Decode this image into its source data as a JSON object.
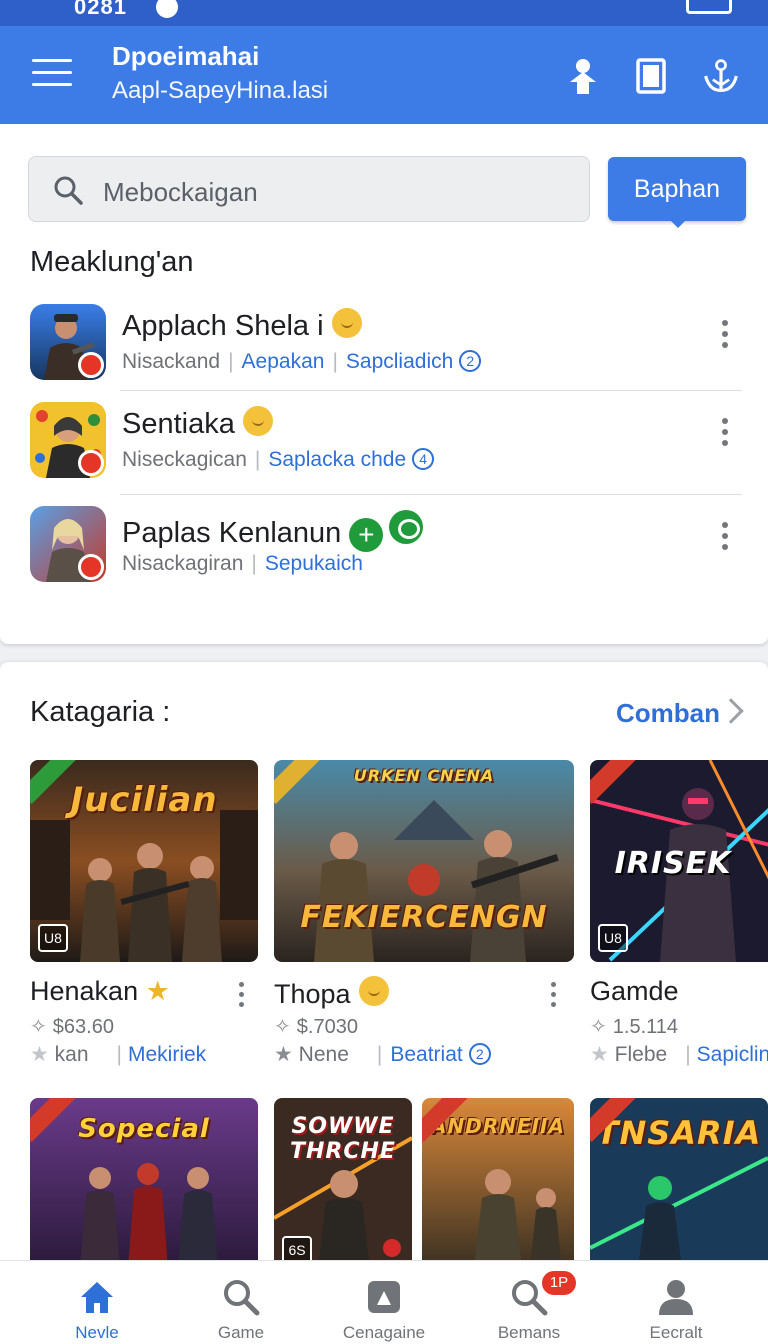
{
  "status_bar": {
    "time": "0281"
  },
  "app_bar": {
    "title": "Dpoeimahai",
    "subtitle": "Aapl-SapeyHina.lasi"
  },
  "search": {
    "placeholder": "Mebockaigan",
    "button_label": "Baphan"
  },
  "recent": {
    "heading": "Meaklung'an",
    "items": [
      {
        "title": "Applach Shela i",
        "meta1": "Nisackand",
        "meta2": "Aepakan",
        "meta3": "Sapcliadich",
        "num": "2"
      },
      {
        "title": "Sentiaka",
        "meta1": "Niseckagican",
        "meta2": "Saplacka chde",
        "num": "4"
      },
      {
        "title": "Paplas Kenlanun",
        "meta1": "Nisackagiran",
        "meta2": "Sepukaich"
      }
    ]
  },
  "categories": {
    "heading": "Katagaria :",
    "see_all": "Comban",
    "games": [
      {
        "title": "Henakan",
        "price": "$63.60",
        "rating_word": "kan",
        "tag": "Mekiriek",
        "thumb_text": "Jucilian",
        "age": "U8"
      },
      {
        "title": "Thopa",
        "price": "$.7030",
        "rating_word": "Nene",
        "tag": "Beatriat",
        "num": "2",
        "thumb_text": "FEKIERCENGN",
        "thumb_top": "URKEN CNENA"
      },
      {
        "title": "Gamde",
        "price": "1.5.114",
        "rating_word": "Flebe",
        "tag": "Sapiclin",
        "thumb_text": "IRISEK",
        "age": "U8"
      }
    ],
    "row2": [
      {
        "thumb_text": "Sopecial"
      },
      {
        "thumb_text": "SOWWE THRCHE"
      },
      {
        "thumb_text": "ANDRNEIIA"
      },
      {
        "thumb_text": "TNSARIA"
      }
    ],
    "row2_age": "6S"
  },
  "bottom_nav": [
    {
      "label": "Nevle",
      "icon": "home-icon",
      "active": true
    },
    {
      "label": "Game",
      "icon": "search-icon"
    },
    {
      "label": "Cenagaine",
      "icon": "store-icon"
    },
    {
      "label": "Bemans",
      "icon": "search-badge-icon",
      "badge": "1P"
    },
    {
      "label": "Eecralt",
      "icon": "profile-icon"
    }
  ],
  "colors": {
    "primary": "#3d7be6",
    "link": "#2e6fd8",
    "status_bar": "#2f5fc9"
  }
}
